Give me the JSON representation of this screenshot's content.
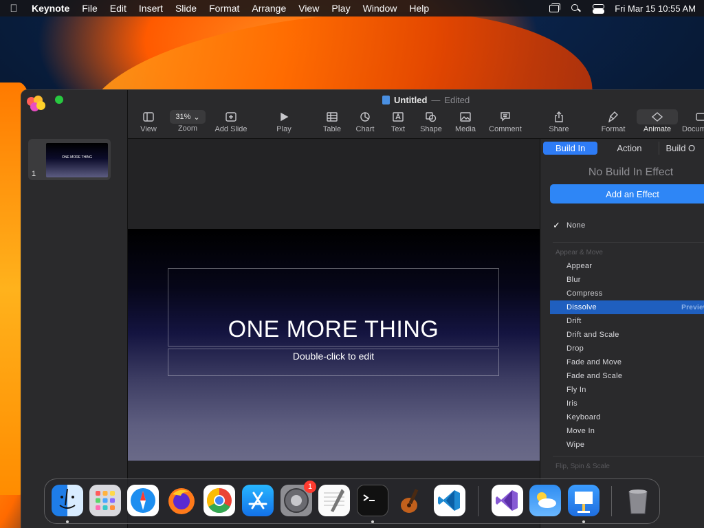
{
  "menubar": {
    "apple": "",
    "app_name": "Keynote",
    "items": [
      "File",
      "Edit",
      "Insert",
      "Slide",
      "Format",
      "Arrange",
      "View",
      "Play",
      "Window",
      "Help"
    ],
    "datetime": "Fri Mar 15  10:55 AM"
  },
  "window": {
    "title": "Untitled",
    "separator": "—",
    "edited_label": "Edited"
  },
  "slides": [
    {
      "number": "1",
      "thumb_text": "ONE MORE THING"
    }
  ],
  "toolbar": {
    "view_label": "View",
    "zoom_value": "31%",
    "zoom_label": "Zoom",
    "add_slide_label": "Add Slide",
    "play_label": "Play",
    "table_label": "Table",
    "chart_label": "Chart",
    "text_label": "Text",
    "shape_label": "Shape",
    "media_label": "Media",
    "comment_label": "Comment",
    "share_label": "Share",
    "format_label": "Format",
    "animate_label": "Animate",
    "document_label": "Docum"
  },
  "slide": {
    "title": "ONE MORE THING",
    "subtitle_placeholder": "Double-click to edit"
  },
  "inspector": {
    "tabs": [
      "Build In",
      "Action",
      "Build O"
    ],
    "active_tab": "Build In",
    "no_effect_label": "No Build In Effect",
    "add_effect_label": "Add an Effect",
    "none_label": "None",
    "group_appear": "Appear & Move",
    "effects": [
      "Appear",
      "Blur",
      "Compress",
      "Dissolve",
      "Drift",
      "Drift and Scale",
      "Drop",
      "Fade and Move",
      "Fade and Scale",
      "Fly In",
      "Iris",
      "Keyboard",
      "Move In",
      "Wipe"
    ],
    "selected_effect": "Dissolve",
    "preview_label": "Preview",
    "group_flip": "Flip, Spin & Scale"
  },
  "dock": {
    "apps": [
      "Finder",
      "Launchpad",
      "Safari",
      "Firefox",
      "Chrome",
      "App Store",
      "System Settings",
      "TextEdit",
      "Terminal",
      "GarageBand",
      "Visual Studio Code",
      "Visual Studio",
      "Weather",
      "Keynote",
      "Trash"
    ],
    "settings_badge": "1"
  },
  "colors": {
    "accent": "#2e86f6",
    "selection": "#1f5fbf"
  }
}
